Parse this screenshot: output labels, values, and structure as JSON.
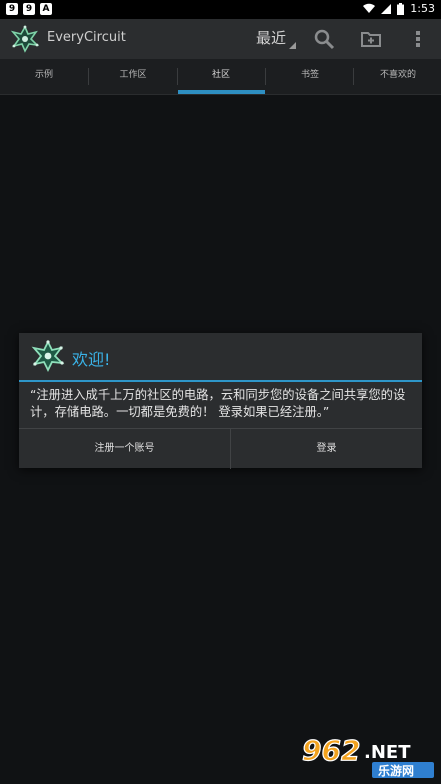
{
  "statusbar": {
    "left_badges": [
      "9",
      "9",
      "A"
    ],
    "time": "1:53"
  },
  "actionbar": {
    "app_title": "EveryCircuit",
    "sort_value": "最近",
    "icons": [
      "app-logo-icon",
      "search-icon",
      "new-circuit-icon",
      "overflow-menu-icon"
    ]
  },
  "tabs": [
    {
      "label": "示例"
    },
    {
      "label": "工作区"
    },
    {
      "label": "社区",
      "selected": true
    },
    {
      "label": "书签"
    },
    {
      "label": "不喜欢的"
    }
  ],
  "dialog": {
    "title": "欢迎!",
    "message": "“注册进入成千上万的社区的电路，云和同步您的设备之间共享您的设计，存储电路。一切都是免费的！ 登录如果已经注册。”",
    "register_button": "注册一个账号",
    "login_button": "登录"
  },
  "watermark": {
    "brand": "962",
    "suffix": ".NET",
    "subtitle": "乐游网"
  },
  "colors": {
    "accent": "#2e8fc2",
    "dialog_title": "#3ab3e8",
    "background": "#101214",
    "actionbar": "#2b2d2f"
  }
}
